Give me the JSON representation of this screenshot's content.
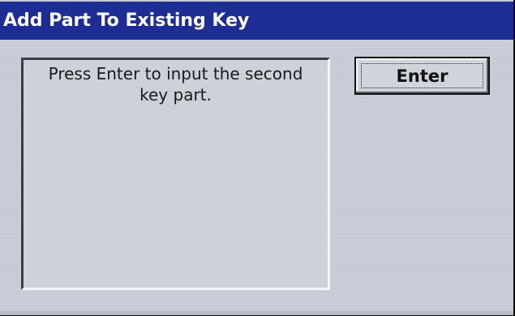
{
  "window": {
    "title": "Add Part To Existing Key"
  },
  "message": {
    "text_line1": "Press Enter to input the second",
    "text_line2": "key part."
  },
  "buttons": {
    "enter_label": "Enter"
  },
  "colors": {
    "titlebar": "#1d2d94",
    "title_text": "#ffffff",
    "background": "#c9ced8"
  }
}
